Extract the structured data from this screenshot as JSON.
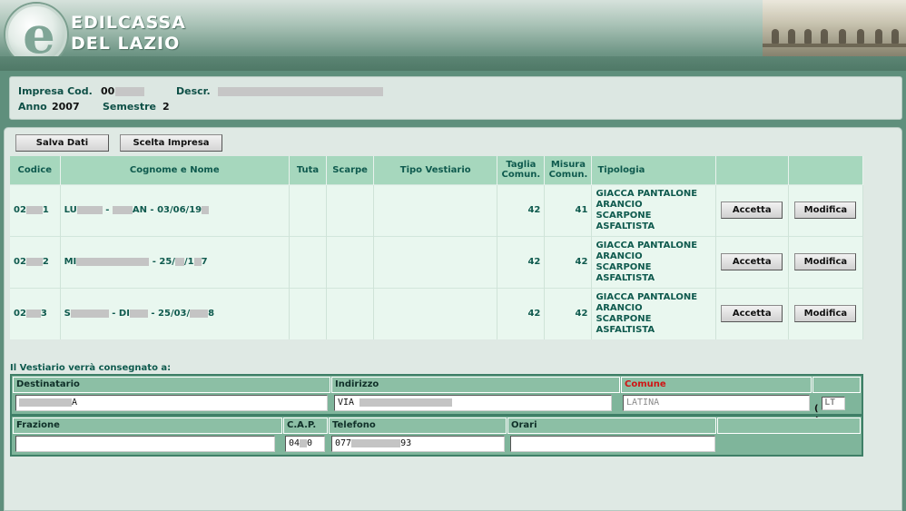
{
  "brand": {
    "line1": "EDILCASSA",
    "line2": "DEL LAZIO",
    "logo_letter": "e"
  },
  "info": {
    "impresa_label": "Impresa Cod.",
    "impresa_value": "00",
    "descr_label": "Descr.",
    "anno_label": "Anno",
    "anno_value": "2007",
    "semestre_label": "Semestre",
    "semestre_value": "2"
  },
  "toolbar": {
    "save_label": "Salva Dati",
    "choose_label": "Scelta Impresa"
  },
  "table": {
    "headers": [
      "Codice",
      "Cognome e Nome",
      "Tuta",
      "Scarpe",
      "Tipo Vestiario",
      "Taglia Comun.",
      "Misura Comun.",
      "Tipologia",
      "",
      ""
    ],
    "rows": [
      {
        "code_a": "02",
        "code_b": "1",
        "name_a": "LU",
        "name_b": " - ",
        "name_c": "AN - 03/06/19",
        "taglia": "42",
        "misura": "41",
        "tipologia": [
          "GIACCA PANTALONE",
          "ARANCIO",
          "SCARPONE",
          "ASFALTISTA"
        ],
        "accept": "Accetta",
        "modify": "Modifica"
      },
      {
        "code_a": "02",
        "code_b": "2",
        "name_a": "MI",
        "name_b": " - 25/",
        "name_c": "/1",
        "name_d": "7",
        "taglia": "42",
        "misura": "42",
        "tipologia": [
          "GIACCA PANTALONE",
          "ARANCIO",
          "SCARPONE",
          "ASFALTISTA"
        ],
        "accept": "Accetta",
        "modify": "Modifica"
      },
      {
        "code_a": "02",
        "code_b": "3",
        "name_a": "S",
        "name_b": " - DI",
        "name_c": " - 25/03/",
        "name_d": "8",
        "taglia": "42",
        "misura": "42",
        "tipologia": [
          "GIACCA PANTALONE",
          "ARANCIO",
          "SCARPONE",
          "ASFALTISTA"
        ],
        "accept": "Accetta",
        "modify": "Modifica"
      }
    ]
  },
  "delivery": {
    "title": "Il Vestiario verrà consegnato a:",
    "destinatario_label": "Destinatario",
    "destinatario_value": "A",
    "indirizzo_label": "Indirizzo",
    "indirizzo_value": "VIA",
    "comune_label": "Comune",
    "comune_value": "LATINA",
    "prov_value": "LT",
    "frazione_label": "Frazione",
    "frazione_value": "",
    "cap_label": "C.A.P.",
    "cap_value": "04",
    "cap_value_end": "0",
    "telefono_label": "Telefono",
    "telefono_value": "077",
    "telefono_value_end": "93",
    "orari_label": "Orari",
    "orari_value": ""
  },
  "colors": {
    "accent": "#0f5a4e",
    "required": "#d01414",
    "header_bg": "#a6d7bd"
  }
}
